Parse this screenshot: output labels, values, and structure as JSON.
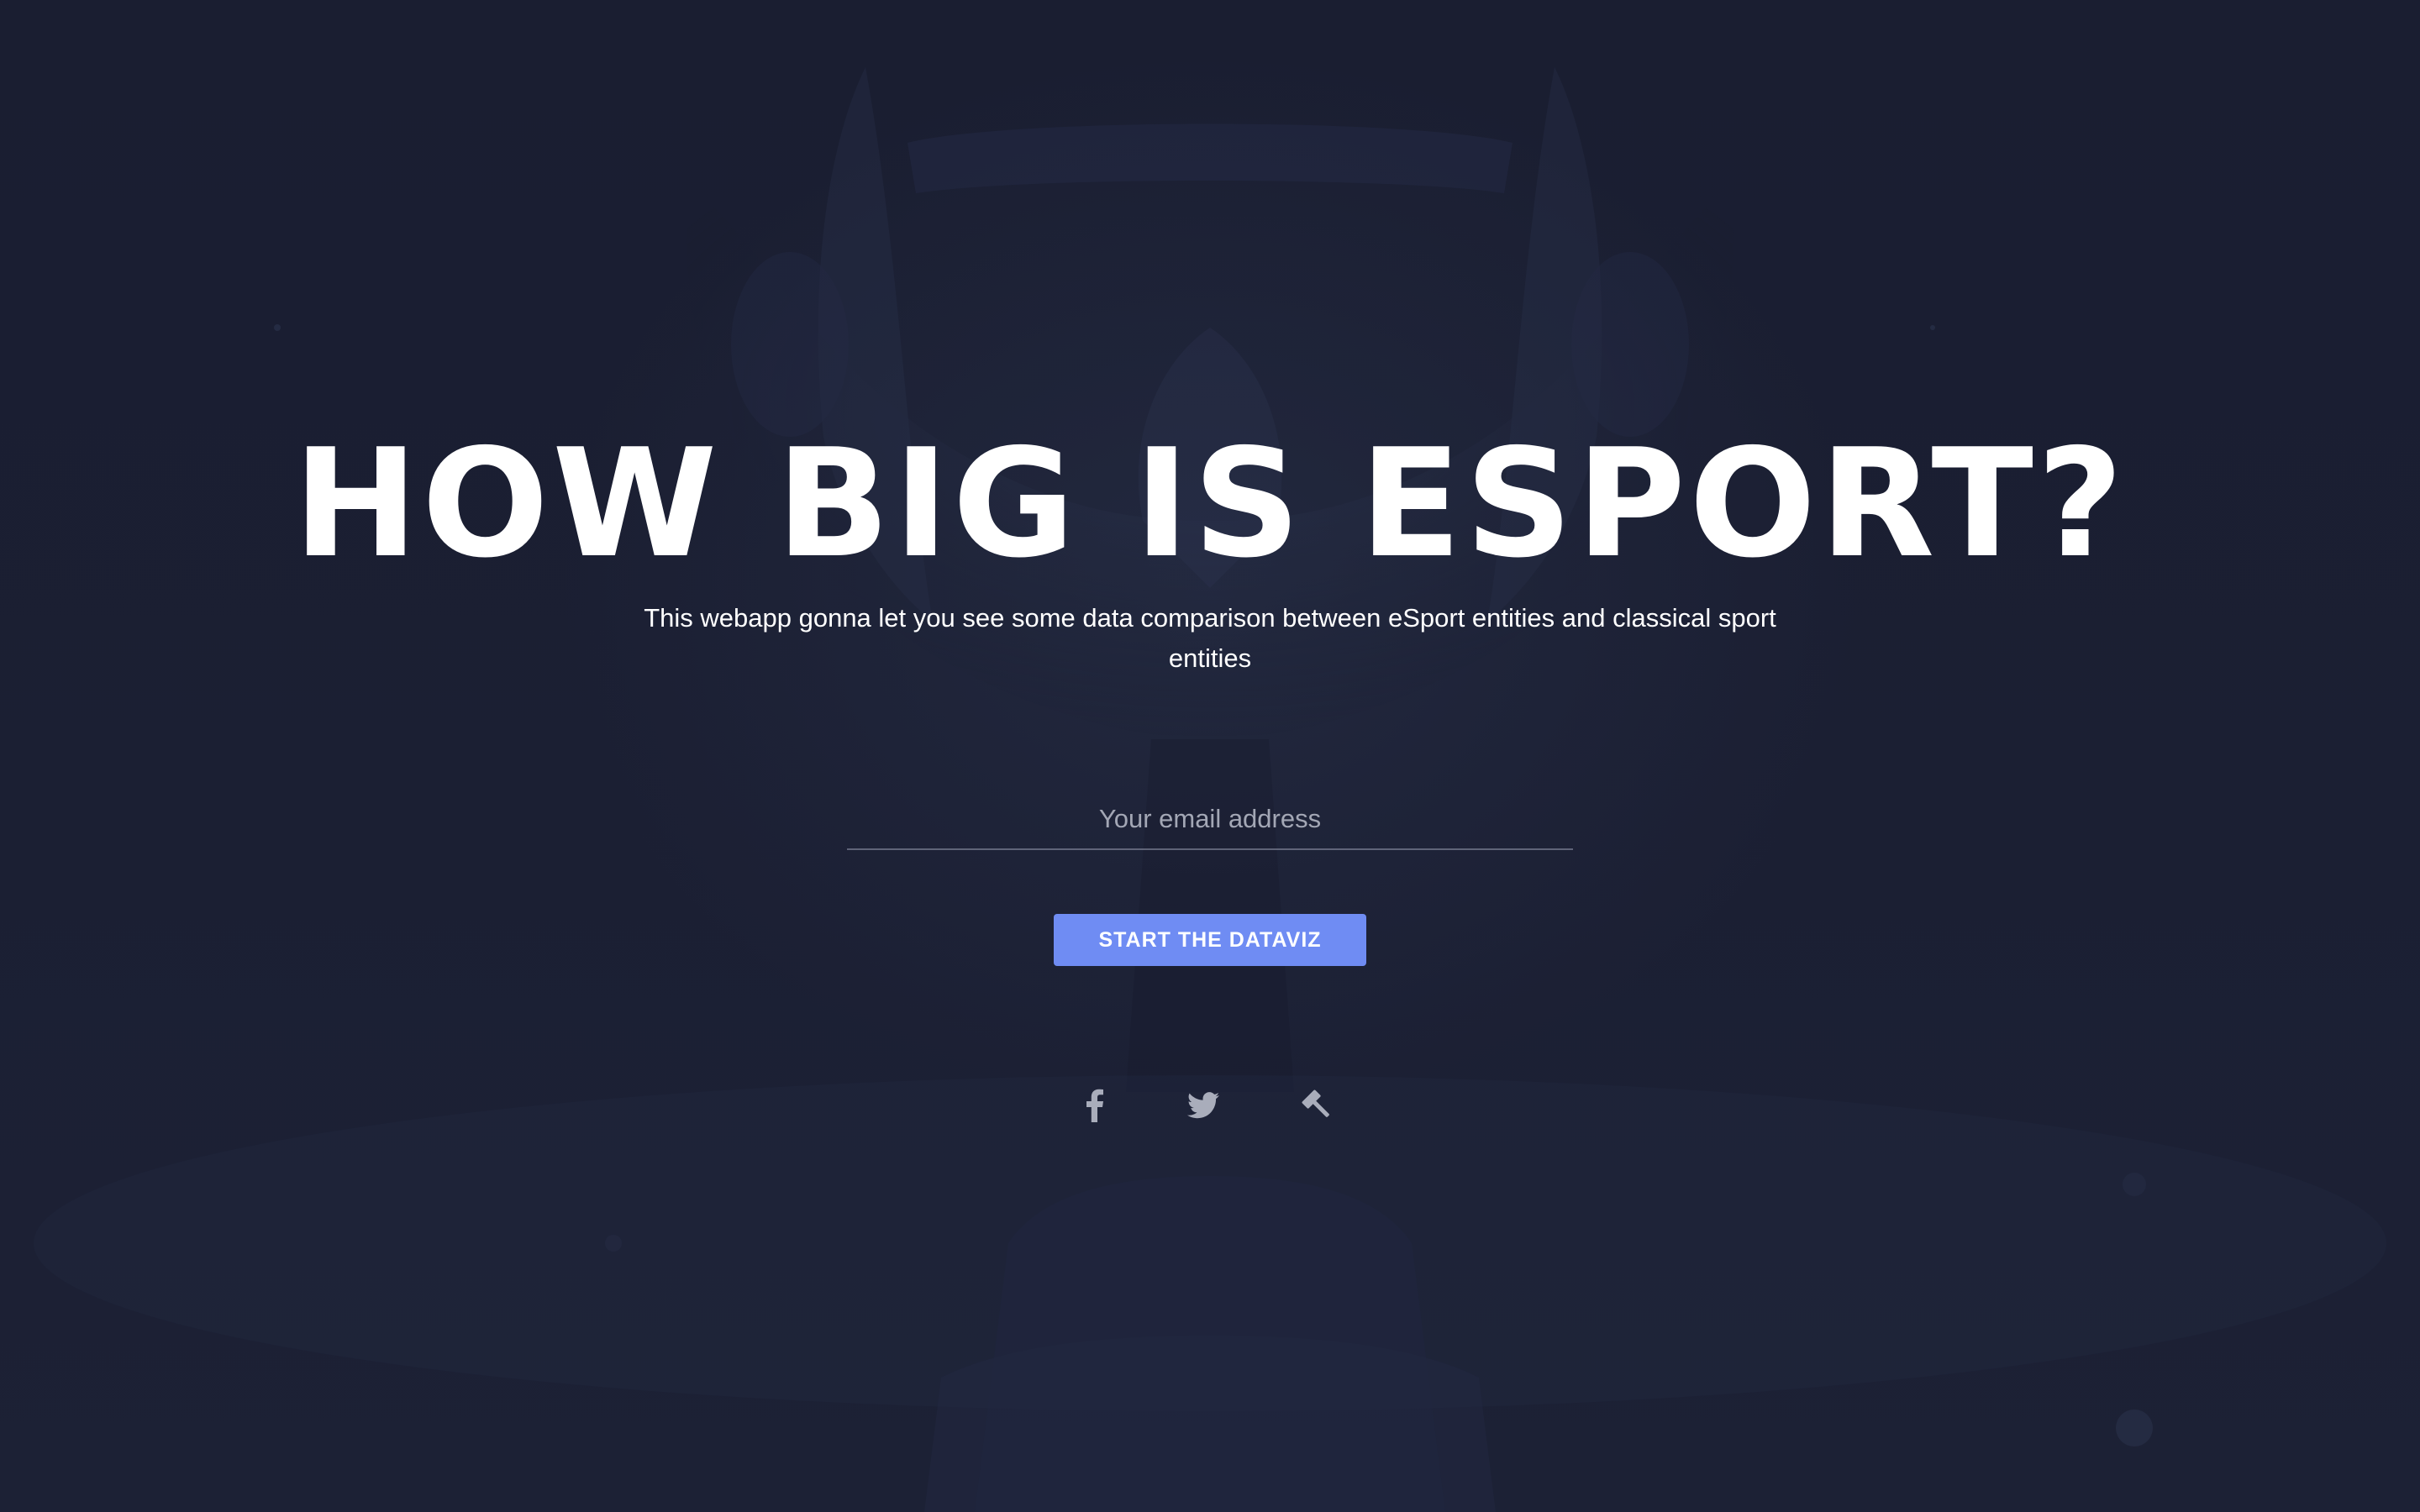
{
  "hero": {
    "title": "HOW BIG IS ESPORT?",
    "subtitle": "This webapp gonna let you see some data comparison between eSport entities and classical sport entities"
  },
  "form": {
    "email_placeholder": "Your email address",
    "email_value": "",
    "submit_label": "START THE DATAVIZ"
  },
  "social": {
    "items": [
      {
        "icon": "facebook-icon"
      },
      {
        "icon": "twitter-icon"
      },
      {
        "icon": "hammer-icon"
      }
    ]
  },
  "colors": {
    "background": "#1a1e30",
    "accent": "#6f8cf3",
    "text": "#ffffff",
    "icon": "#a9adbb"
  }
}
